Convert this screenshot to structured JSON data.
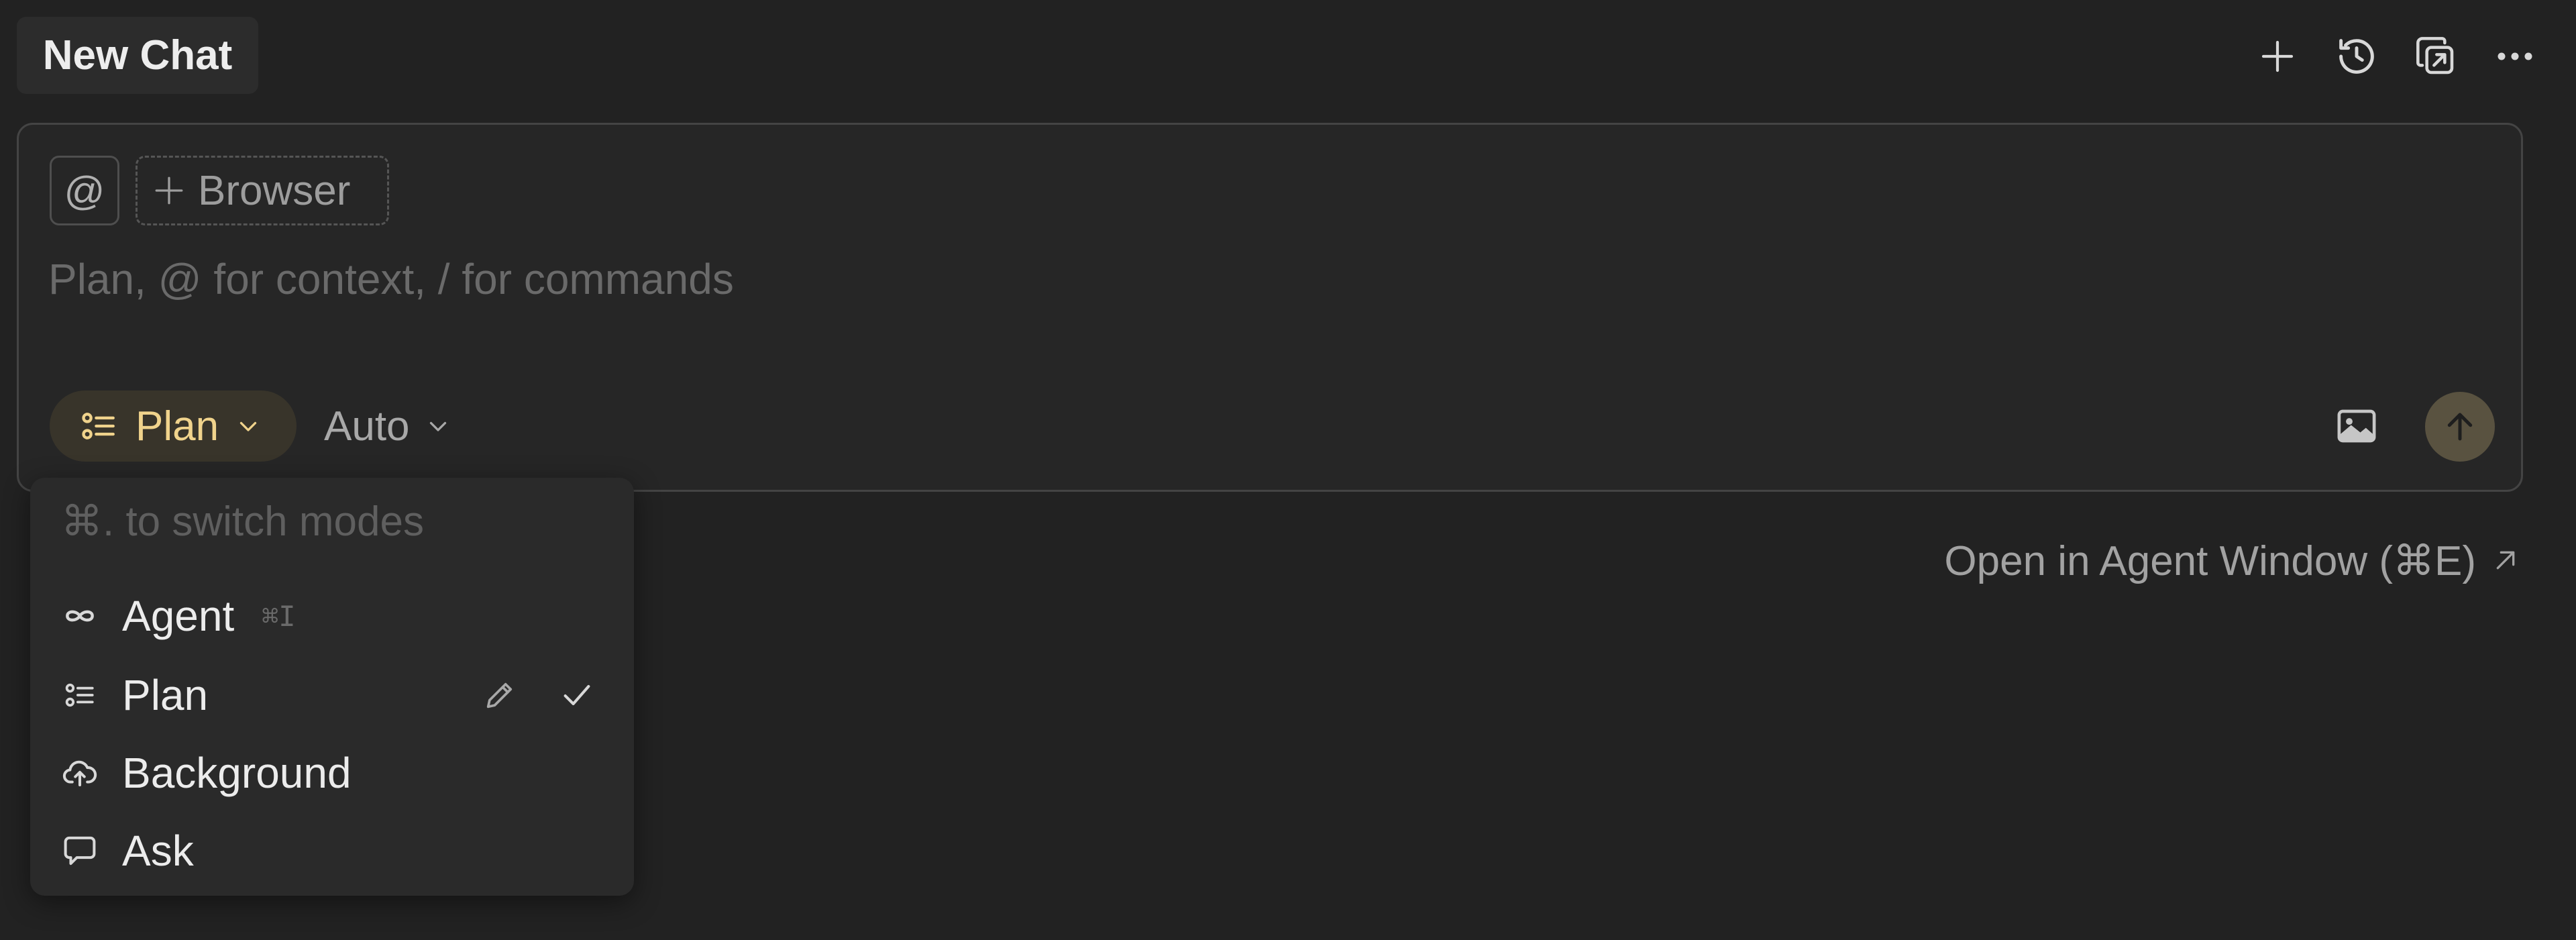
{
  "header": {
    "title": "New Chat",
    "actions": [
      {
        "name": "new-chat-button",
        "icon": "plus-icon"
      },
      {
        "name": "history-button",
        "icon": "history-icon"
      },
      {
        "name": "open-in-window-button",
        "icon": "external-window-icon"
      },
      {
        "name": "more-button",
        "icon": "more-horizontal-icon"
      }
    ]
  },
  "composer": {
    "context_symbol": "@",
    "browser_chip_label": "Browser",
    "input_placeholder": "Plan, @ for context, / for commands",
    "input_value": "",
    "mode_label": "Plan",
    "model_label": "Auto",
    "accent_color": "#f0d38c"
  },
  "agent_link": {
    "label": "Open in Agent Window (⌘E)",
    "icon": "arrow-up-right-icon"
  },
  "mode_menu": {
    "hint": "⌘. to switch modes",
    "items": [
      {
        "label": "Agent",
        "icon": "infinity-icon",
        "shortcut": "⌘I",
        "selected": false
      },
      {
        "label": "Plan",
        "icon": "checklist-icon",
        "shortcut": "",
        "selected": true
      },
      {
        "label": "Background",
        "icon": "cloud-upload-icon",
        "shortcut": "",
        "selected": false
      },
      {
        "label": "Ask",
        "icon": "chat-bubble-icon",
        "shortcut": "",
        "selected": false
      }
    ]
  }
}
